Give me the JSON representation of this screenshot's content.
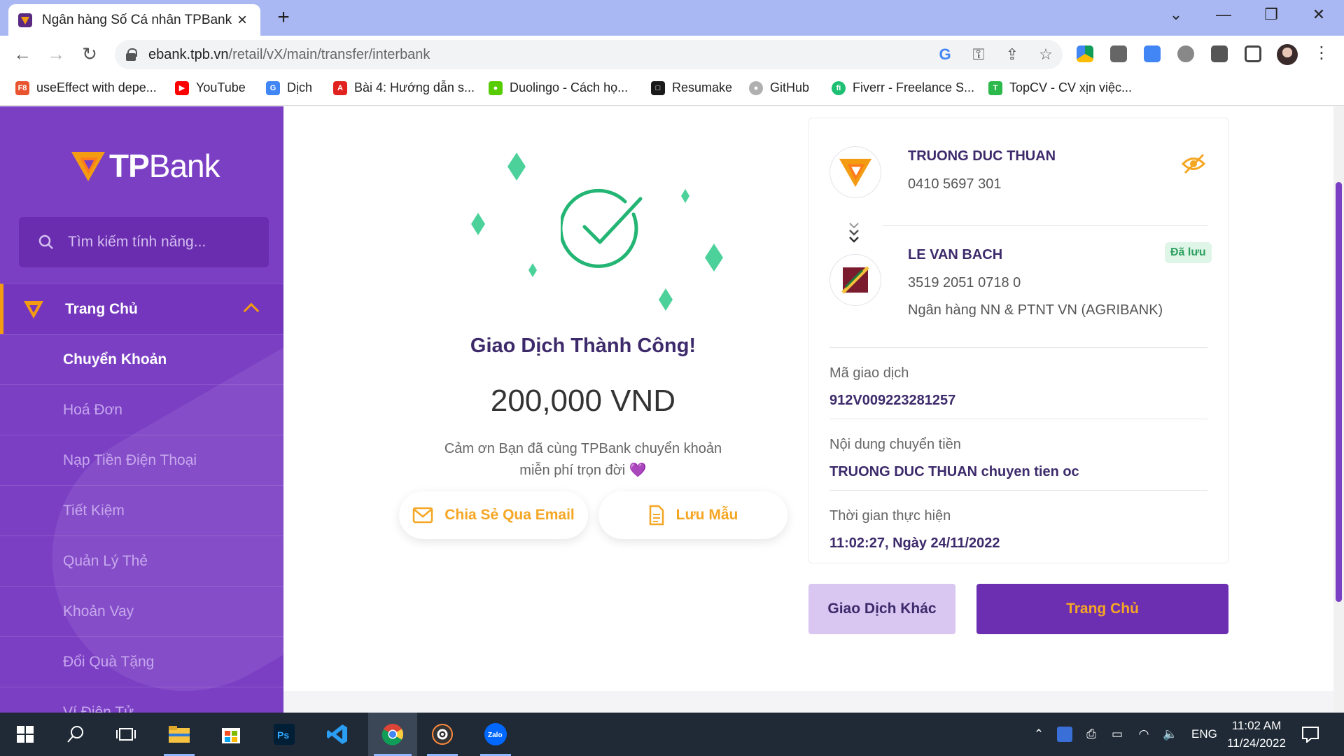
{
  "browser": {
    "tab_title": "Ngân hàng Số Cá nhân TPBank",
    "url_host": "ebank.tpb.vn",
    "url_path": "/retail/vX/main/transfer/interbank",
    "bookmarks": [
      {
        "label": "useEffect with depe...",
        "icon": "f8-icon",
        "color": "#e8542f"
      },
      {
        "label": "YouTube",
        "icon": "youtube-icon",
        "color": "#ff0000"
      },
      {
        "label": "Dịch",
        "icon": "translate-icon",
        "color": "#4285f4"
      },
      {
        "label": "Bài 4: Hướng dẫn s...",
        "icon": "adobe-icon",
        "color": "#e0211d"
      },
      {
        "label": "Duolingo - Cách họ...",
        "icon": "duolingo-icon",
        "color": "#58cc02"
      },
      {
        "label": "Resumake",
        "icon": "resumake-icon",
        "color": "#1a1a1a"
      },
      {
        "label": "GitHub",
        "icon": "github-icon",
        "color": "#b0b0b0"
      },
      {
        "label": "Fiverr - Freelance S...",
        "icon": "fiverr-icon",
        "color": "#1dbf73"
      },
      {
        "label": "TopCV - CV xịn việc...",
        "icon": "topcv-icon",
        "color": "#2bb94b"
      }
    ]
  },
  "sidebar": {
    "brand": "TPBank",
    "search_placeholder": "Tìm kiếm tính năng...",
    "home_label": "Trang Chủ",
    "items": [
      "Chuyển Khoản",
      "Hoá Đơn",
      "Nạp Tiền Điện Thoại",
      "Tiết Kiệm",
      "Quản Lý Thẻ",
      "Khoản Vay",
      "Đổi Quà Tặng",
      "Ví Điện Tử"
    ]
  },
  "result": {
    "title": "Giao Dịch Thành Công!",
    "amount": "200,000 VND",
    "thanks_line1": "Cảm ơn Bạn đã cùng TPBank chuyển khoản",
    "thanks_line2": "miễn phí trọn đời",
    "share_email": "Chia Sẻ Qua Email",
    "save_template": "Lưu Mẫu"
  },
  "details": {
    "sender_name": "TRUONG DUC THUAN",
    "sender_account": "0410 5697 301",
    "receiver_name": "LE VAN BACH",
    "receiver_account": "3519 2051 0718 0",
    "receiver_bank": "Ngân hàng NN & PTNT VN (AGRIBANK)",
    "saved_badge": "Đã lưu",
    "txn_id_label": "Mã giao dịch",
    "txn_id": "912V009223281257",
    "content_label": "Nội dung chuyển tiền",
    "content": "TRUONG DUC THUAN chuyen tien oc",
    "time_label": "Thời gian thực hiện",
    "time": "11:02:27, Ngày 24/11/2022"
  },
  "actions": {
    "other_txn": "Giao Dịch Khác",
    "home": "Trang Chủ"
  },
  "taskbar": {
    "lang": "ENG",
    "time": "11:02 AM",
    "date": "11/24/2022"
  },
  "colors": {
    "brand_purple": "#7b3fc4",
    "brand_orange": "#f5a623",
    "success_green": "#22b573"
  }
}
